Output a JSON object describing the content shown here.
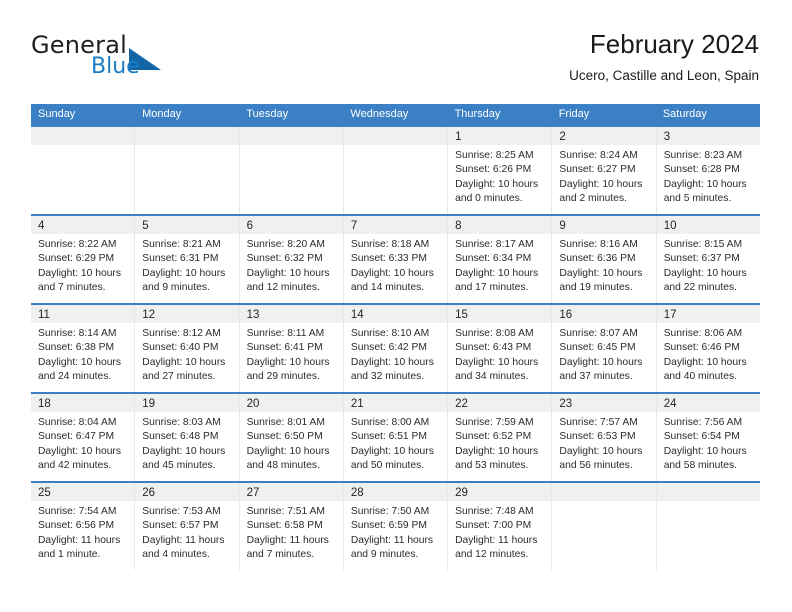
{
  "brand": {
    "name_top": "General",
    "name_bottom": "Blue",
    "accent_color": "#1b7dc4",
    "triangle_color": "#1266a8"
  },
  "header": {
    "title": "February 2024",
    "subtitle": "Ucero, Castille and Leon, Spain"
  },
  "calendar": {
    "header_bg": "#3b7fc4",
    "header_text_color": "#ffffff",
    "day_band_bg": "#f0f0f0",
    "weekdays": [
      "Sunday",
      "Monday",
      "Tuesday",
      "Wednesday",
      "Thursday",
      "Friday",
      "Saturday"
    ],
    "weeks": [
      [
        {
          "day": ""
        },
        {
          "day": ""
        },
        {
          "day": ""
        },
        {
          "day": ""
        },
        {
          "day": "1",
          "sunrise": "Sunrise: 8:25 AM",
          "sunset": "Sunset: 6:26 PM",
          "daylight_line1": "Daylight: 10 hours",
          "daylight_line2": "and 0 minutes."
        },
        {
          "day": "2",
          "sunrise": "Sunrise: 8:24 AM",
          "sunset": "Sunset: 6:27 PM",
          "daylight_line1": "Daylight: 10 hours",
          "daylight_line2": "and 2 minutes."
        },
        {
          "day": "3",
          "sunrise": "Sunrise: 8:23 AM",
          "sunset": "Sunset: 6:28 PM",
          "daylight_line1": "Daylight: 10 hours",
          "daylight_line2": "and 5 minutes."
        }
      ],
      [
        {
          "day": "4",
          "sunrise": "Sunrise: 8:22 AM",
          "sunset": "Sunset: 6:29 PM",
          "daylight_line1": "Daylight: 10 hours",
          "daylight_line2": "and 7 minutes."
        },
        {
          "day": "5",
          "sunrise": "Sunrise: 8:21 AM",
          "sunset": "Sunset: 6:31 PM",
          "daylight_line1": "Daylight: 10 hours",
          "daylight_line2": "and 9 minutes."
        },
        {
          "day": "6",
          "sunrise": "Sunrise: 8:20 AM",
          "sunset": "Sunset: 6:32 PM",
          "daylight_line1": "Daylight: 10 hours",
          "daylight_line2": "and 12 minutes."
        },
        {
          "day": "7",
          "sunrise": "Sunrise: 8:18 AM",
          "sunset": "Sunset: 6:33 PM",
          "daylight_line1": "Daylight: 10 hours",
          "daylight_line2": "and 14 minutes."
        },
        {
          "day": "8",
          "sunrise": "Sunrise: 8:17 AM",
          "sunset": "Sunset: 6:34 PM",
          "daylight_line1": "Daylight: 10 hours",
          "daylight_line2": "and 17 minutes."
        },
        {
          "day": "9",
          "sunrise": "Sunrise: 8:16 AM",
          "sunset": "Sunset: 6:36 PM",
          "daylight_line1": "Daylight: 10 hours",
          "daylight_line2": "and 19 minutes."
        },
        {
          "day": "10",
          "sunrise": "Sunrise: 8:15 AM",
          "sunset": "Sunset: 6:37 PM",
          "daylight_line1": "Daylight: 10 hours",
          "daylight_line2": "and 22 minutes."
        }
      ],
      [
        {
          "day": "11",
          "sunrise": "Sunrise: 8:14 AM",
          "sunset": "Sunset: 6:38 PM",
          "daylight_line1": "Daylight: 10 hours",
          "daylight_line2": "and 24 minutes."
        },
        {
          "day": "12",
          "sunrise": "Sunrise: 8:12 AM",
          "sunset": "Sunset: 6:40 PM",
          "daylight_line1": "Daylight: 10 hours",
          "daylight_line2": "and 27 minutes."
        },
        {
          "day": "13",
          "sunrise": "Sunrise: 8:11 AM",
          "sunset": "Sunset: 6:41 PM",
          "daylight_line1": "Daylight: 10 hours",
          "daylight_line2": "and 29 minutes."
        },
        {
          "day": "14",
          "sunrise": "Sunrise: 8:10 AM",
          "sunset": "Sunset: 6:42 PM",
          "daylight_line1": "Daylight: 10 hours",
          "daylight_line2": "and 32 minutes."
        },
        {
          "day": "15",
          "sunrise": "Sunrise: 8:08 AM",
          "sunset": "Sunset: 6:43 PM",
          "daylight_line1": "Daylight: 10 hours",
          "daylight_line2": "and 34 minutes."
        },
        {
          "day": "16",
          "sunrise": "Sunrise: 8:07 AM",
          "sunset": "Sunset: 6:45 PM",
          "daylight_line1": "Daylight: 10 hours",
          "daylight_line2": "and 37 minutes."
        },
        {
          "day": "17",
          "sunrise": "Sunrise: 8:06 AM",
          "sunset": "Sunset: 6:46 PM",
          "daylight_line1": "Daylight: 10 hours",
          "daylight_line2": "and 40 minutes."
        }
      ],
      [
        {
          "day": "18",
          "sunrise": "Sunrise: 8:04 AM",
          "sunset": "Sunset: 6:47 PM",
          "daylight_line1": "Daylight: 10 hours",
          "daylight_line2": "and 42 minutes."
        },
        {
          "day": "19",
          "sunrise": "Sunrise: 8:03 AM",
          "sunset": "Sunset: 6:48 PM",
          "daylight_line1": "Daylight: 10 hours",
          "daylight_line2": "and 45 minutes."
        },
        {
          "day": "20",
          "sunrise": "Sunrise: 8:01 AM",
          "sunset": "Sunset: 6:50 PM",
          "daylight_line1": "Daylight: 10 hours",
          "daylight_line2": "and 48 minutes."
        },
        {
          "day": "21",
          "sunrise": "Sunrise: 8:00 AM",
          "sunset": "Sunset: 6:51 PM",
          "daylight_line1": "Daylight: 10 hours",
          "daylight_line2": "and 50 minutes."
        },
        {
          "day": "22",
          "sunrise": "Sunrise: 7:59 AM",
          "sunset": "Sunset: 6:52 PM",
          "daylight_line1": "Daylight: 10 hours",
          "daylight_line2": "and 53 minutes."
        },
        {
          "day": "23",
          "sunrise": "Sunrise: 7:57 AM",
          "sunset": "Sunset: 6:53 PM",
          "daylight_line1": "Daylight: 10 hours",
          "daylight_line2": "and 56 minutes."
        },
        {
          "day": "24",
          "sunrise": "Sunrise: 7:56 AM",
          "sunset": "Sunset: 6:54 PM",
          "daylight_line1": "Daylight: 10 hours",
          "daylight_line2": "and 58 minutes."
        }
      ],
      [
        {
          "day": "25",
          "sunrise": "Sunrise: 7:54 AM",
          "sunset": "Sunset: 6:56 PM",
          "daylight_line1": "Daylight: 11 hours",
          "daylight_line2": "and 1 minute."
        },
        {
          "day": "26",
          "sunrise": "Sunrise: 7:53 AM",
          "sunset": "Sunset: 6:57 PM",
          "daylight_line1": "Daylight: 11 hours",
          "daylight_line2": "and 4 minutes."
        },
        {
          "day": "27",
          "sunrise": "Sunrise: 7:51 AM",
          "sunset": "Sunset: 6:58 PM",
          "daylight_line1": "Daylight: 11 hours",
          "daylight_line2": "and 7 minutes."
        },
        {
          "day": "28",
          "sunrise": "Sunrise: 7:50 AM",
          "sunset": "Sunset: 6:59 PM",
          "daylight_line1": "Daylight: 11 hours",
          "daylight_line2": "and 9 minutes."
        },
        {
          "day": "29",
          "sunrise": "Sunrise: 7:48 AM",
          "sunset": "Sunset: 7:00 PM",
          "daylight_line1": "Daylight: 11 hours",
          "daylight_line2": "and 12 minutes."
        },
        {
          "day": ""
        },
        {
          "day": ""
        }
      ]
    ]
  }
}
